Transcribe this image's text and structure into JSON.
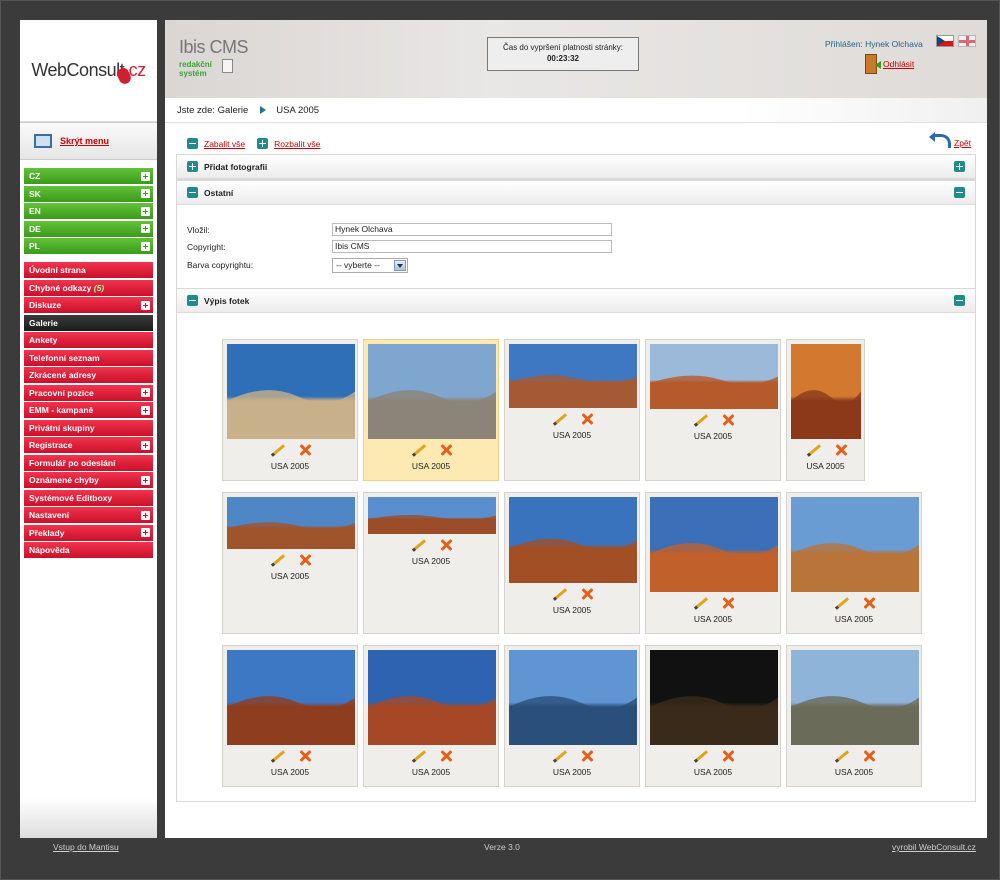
{
  "brand": {
    "logo_web": "WebConsult",
    "logo_cz": ".cz"
  },
  "sidebar": {
    "hide_menu": "Skrýt menu",
    "languages": [
      "CZ",
      "SK",
      "EN",
      "DE",
      "PL"
    ],
    "items": [
      {
        "label": "Úvodní strana",
        "plus": false
      },
      {
        "label": "Chybné odkazy",
        "count": "(5)",
        "plus": false
      },
      {
        "label": "Diskuze",
        "plus": true
      },
      {
        "label": "Galerie",
        "plus": false,
        "active": true
      },
      {
        "label": "Ankety",
        "plus": false
      },
      {
        "label": "Telefonní seznam",
        "plus": false
      },
      {
        "label": "Zkrácené adresy",
        "plus": false
      },
      {
        "label": "Pracovní pozice",
        "plus": true
      },
      {
        "label": "EMM - kampaně",
        "plus": true
      },
      {
        "label": "Privátní skupiny",
        "plus": false
      },
      {
        "label": "Registrace",
        "plus": true
      },
      {
        "label": "Formulář po odeslání",
        "plus": false
      },
      {
        "label": "Oznámené chyby",
        "plus": true
      },
      {
        "label": "Systémové Editboxy",
        "plus": false
      },
      {
        "label": "Nastavení",
        "plus": true
      },
      {
        "label": "Překlady",
        "plus": true
      },
      {
        "label": "Nápověda",
        "plus": false
      }
    ]
  },
  "header": {
    "cms_title": "Ibis CMS",
    "cms_sub1": "redakční",
    "cms_sub2": "systém",
    "timer_label": "Čas do vypršení platnosti stránky:",
    "timer_value": "00:23:32",
    "user": "Přihlášen: Hynek Olchava",
    "logout": "Odhlásit"
  },
  "breadcrumb": {
    "prefix": "Jste zde:",
    "level1": "Galerie",
    "level2": "USA 2005"
  },
  "toolbar": {
    "collapse": "Zabalit vše",
    "expand": "Rozbalit vše",
    "back": "Zpět"
  },
  "panels": {
    "add": "Přidat fotografii",
    "other": "Ostatní",
    "list": "Výpis fotek"
  },
  "form": {
    "author_label": "Vložil:",
    "author_value": "Hynek Olchava",
    "copyright_label": "Copyright:",
    "copyright_value": "Ibis CMS",
    "color_label": "Barva copyrightu:",
    "color_value": "-- vyberte --"
  },
  "photos": [
    {
      "caption": "USA 2005",
      "sky": "#2f6fb7",
      "ground": "#c8b08a",
      "selected": false
    },
    {
      "caption": "USA 2005",
      "sky": "#7fa6cf",
      "ground": "#8c8478",
      "selected": true
    },
    {
      "caption": "USA 2005",
      "sky": "#3e78c2",
      "ground": "#a45a36",
      "selected": false
    },
    {
      "caption": "USA 2005",
      "sky": "#9bb9d8",
      "ground": "#b55a2a",
      "selected": false
    },
    {
      "caption": "USA 2005",
      "sky": "#d2782f",
      "ground": "#8c3a1a",
      "selected": false
    },
    {
      "caption": "USA 2005",
      "sky": "#4f86c6",
      "ground": "#a0542c",
      "selected": false
    },
    {
      "caption": "USA 2005",
      "sky": "#5a8fcf",
      "ground": "#9a4d28",
      "selected": false
    },
    {
      "caption": "USA 2005",
      "sky": "#3a73bd",
      "ground": "#a24f25",
      "selected": false
    },
    {
      "caption": "USA 2005",
      "sky": "#3b6fb8",
      "ground": "#c0602c",
      "selected": false
    },
    {
      "caption": "USA 2005",
      "sky": "#6a9cd4",
      "ground": "#b8743a",
      "selected": false
    },
    {
      "caption": "USA 2005",
      "sky": "#3d78c4",
      "ground": "#8e3d1e",
      "selected": false
    },
    {
      "caption": "USA 2005",
      "sky": "#2d63b0",
      "ground": "#a64826",
      "selected": false
    },
    {
      "caption": "USA 2005",
      "sky": "#5e95d2",
      "ground": "#2a4f7a",
      "selected": false
    },
    {
      "caption": "USA 2005",
      "sky": "#111111",
      "ground": "#3a2a1a",
      "selected": false
    },
    {
      "caption": "USA 2005",
      "sky": "#8fb4da",
      "ground": "#6b6b5a",
      "selected": false
    }
  ],
  "footer": {
    "left": "Vstup do Mantisu",
    "center": "Verze 3.0",
    "right": "vyrobil WebConsult.cz"
  }
}
